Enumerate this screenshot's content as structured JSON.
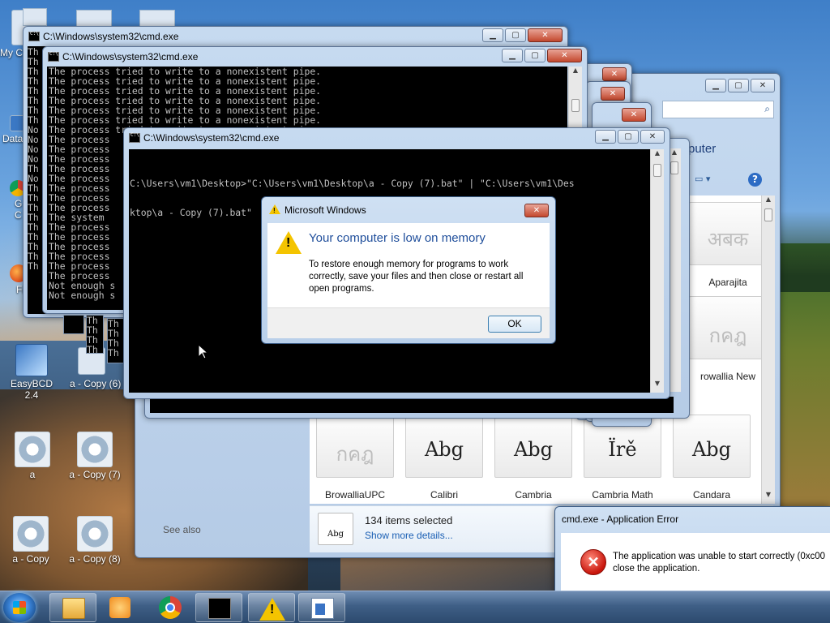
{
  "desktop": {
    "icons": {
      "my_computer": "My C",
      "data": "Data",
      "g_c": "G\nC",
      "firefox": "Firefo",
      "easybcd": "EasyBCD 2.4",
      "copy6": "a - Copy (6)",
      "a": "a",
      "copy7": "a - Copy (7)",
      "a_copy": "a - Copy",
      "copy8": "a - Copy (8)"
    }
  },
  "cmd_back": {
    "title": "C:\\Windows\\system32\\cmd.exe",
    "left_col": [
      "Th",
      "Th",
      "Th",
      "Th",
      "Th",
      "Th",
      "Th",
      "Th",
      "No",
      "No",
      "No",
      "No",
      "Th",
      "No",
      "Th",
      "Th",
      "Th",
      "Th",
      "Th",
      "Th",
      "Th",
      "Th",
      "Th"
    ]
  },
  "cmd_mid": {
    "title": "C:\\Windows\\system32\\cmd.exe",
    "lines": [
      "The process tried to write to a nonexistent pipe.",
      "The process tried to write to a nonexistent pipe.",
      "The process tried to write to a nonexistent pipe.",
      "The process tried to write to a nonexistent pipe.",
      "The process tried to write to a nonexistent pipe.",
      "The process tried to write to a nonexistent pipe.",
      "The process tried to write to a nonexistent pipe.",
      "The process",
      "The process",
      "The process",
      "The process",
      "The process",
      "The process",
      "The process",
      "The process",
      "The system",
      "The process",
      "The process",
      "The process",
      "The process",
      "The process",
      "The process",
      "Not enough s",
      "Not enough s"
    ],
    "peek_lines": [
      "Th",
      "Th",
      "Th",
      "Th"
    ]
  },
  "cmd_front": {
    "title": "C:\\Windows\\system32\\cmd.exe",
    "line1": "C:\\Users\\vm1\\Desktop>\"C:\\Users\\vm1\\Desktop\\a - Copy (7).bat\" | \"C:\\Users\\vm1\\Des",
    "line2": "ktop\\a - Copy (7).bat\""
  },
  "fonts_window": {
    "header_fragment": "puter",
    "fonts": [
      {
        "name": "Aparajita",
        "sample": "अबक"
      },
      {
        "name": "rowallia New",
        "sample": "กคฎ"
      },
      {
        "name": "BrowalliaUPC",
        "sample": "กคฎ"
      },
      {
        "name": "Calibri",
        "sample": "Abg"
      },
      {
        "name": "Cambria",
        "sample": "Abg"
      },
      {
        "name": "Cambria Math",
        "sample": "Ïrě"
      },
      {
        "name": "Candara",
        "sample": "Abg"
      }
    ],
    "see_also": "See also",
    "details": {
      "count": "134 items selected",
      "link": "Show more details...",
      "thumb_sample": "Abg"
    }
  },
  "memory_dialog": {
    "title": "Microsoft Windows",
    "heading": "Your computer is low on memory",
    "message": "To restore enough memory for programs to work correctly, save your files and then close or restart all open programs.",
    "ok": "OK",
    "heading_color": "#1f4e9b"
  },
  "app_error": {
    "title": "cmd.exe - Application Error",
    "message_l1": "The application was unable to start correctly (0xc00",
    "message_l2": "close the application."
  },
  "taskbar": {
    "items": [
      "explorer-icon",
      "media-player-icon",
      "chrome-icon",
      "cmd-icon",
      "warning-icon",
      "fonts-panel-icon"
    ]
  }
}
